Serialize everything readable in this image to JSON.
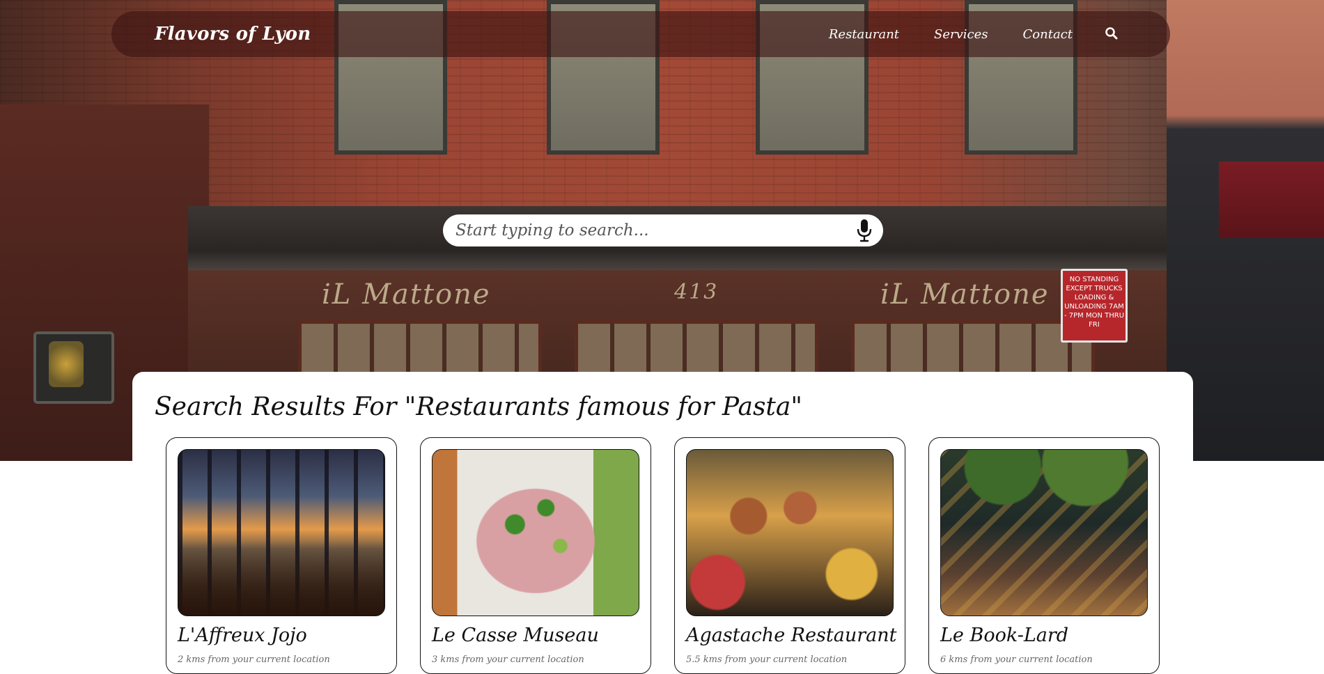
{
  "navbar": {
    "brand": "Flavors of Lyon",
    "links": [
      {
        "label": "Restaurant"
      },
      {
        "label": "Services"
      },
      {
        "label": "Contact"
      }
    ],
    "search_icon": "search-icon"
  },
  "search": {
    "placeholder": "Start typing to search...",
    "value": "",
    "mic_icon": "microphone-icon"
  },
  "results": {
    "title": "Search Results For \"Restaurants famous for Pasta\"",
    "items": [
      {
        "name": "L'Affreux Jojo",
        "distance": "2 kms from your current location"
      },
      {
        "name": "Le Casse Museau",
        "distance": "3 kms from your current location"
      },
      {
        "name": "Agastache Restaurant",
        "distance": "5.5 kms from your current location"
      },
      {
        "name": "Le Book-Lard",
        "distance": "6 kms from your current location"
      }
    ]
  },
  "hero": {
    "sign_text": "iL Mattone",
    "sign_number": "413",
    "street_sign": "NO STANDING EXCEPT TRUCKS LOADING & UNLOADING 7AM - 7PM MON THRU FRI"
  },
  "colors": {
    "navbar_bg": "#3c1412",
    "accent_text": "#ffffff",
    "card_border": "#111111"
  }
}
